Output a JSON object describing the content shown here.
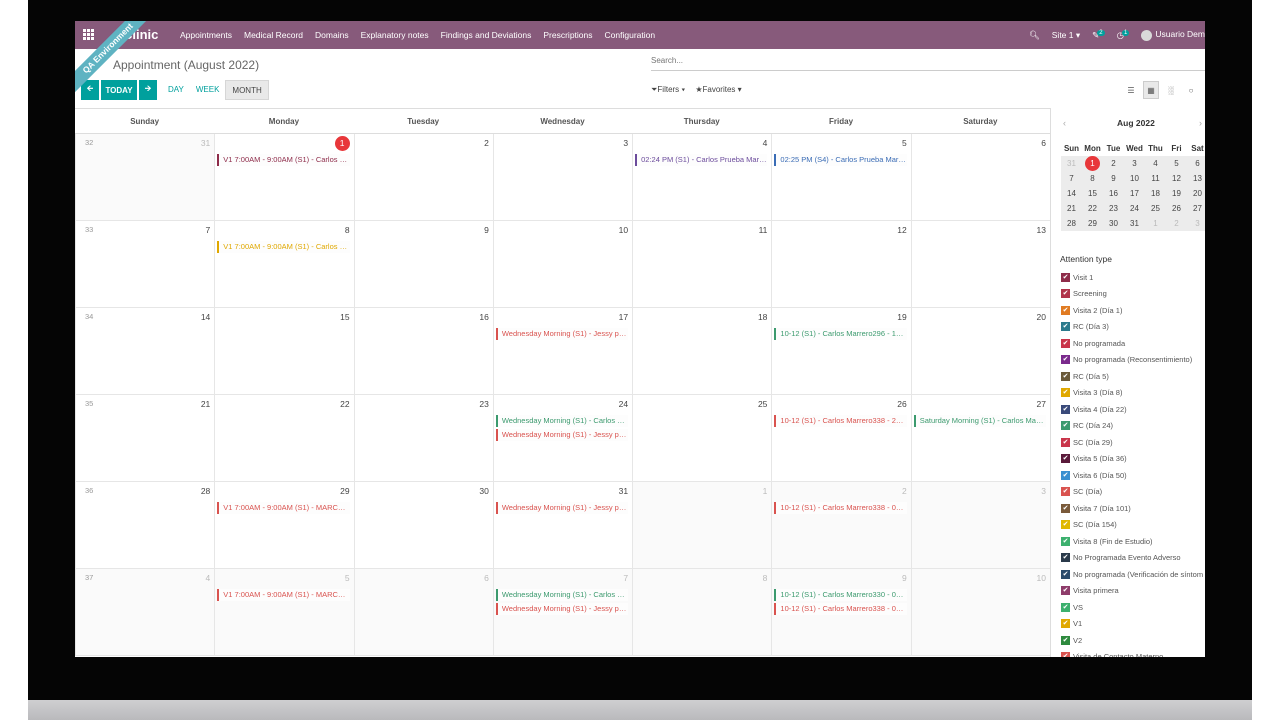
{
  "navbar": {
    "brand": "Clinic",
    "ribbon": "QA Environment",
    "menu": [
      "Appointments",
      "Medical Record",
      "Domains",
      "Explanatory notes",
      "Findings and Deviations",
      "Prescriptions",
      "Configuration"
    ],
    "site": "Site 1",
    "messages_badge": "2",
    "activity_badge": "1",
    "user": "Usuario Dem"
  },
  "control": {
    "breadcrumb": "Appointment (August 2022)",
    "search_placeholder": "Search...",
    "today_label": "TODAY",
    "prev_icon": "arrow-left-icon",
    "next_icon": "arrow-right-icon",
    "scales": [
      "DAY",
      "WEEK",
      "MONTH"
    ],
    "active_scale": "MONTH",
    "filters_label": "Filters",
    "favorites_label": "Favorites"
  },
  "calendar": {
    "weekdays": [
      "Sunday",
      "Monday",
      "Tuesday",
      "Wednesday",
      "Thursday",
      "Friday",
      "Saturday"
    ],
    "weeks": [
      {
        "num": "32",
        "days": [
          {
            "n": "31",
            "out": true,
            "events": []
          },
          {
            "n": "1",
            "today": true,
            "events": [
              {
                "t": "V1 7:00AM - 9:00AM (S1) - Carlos M...",
                "c": "#8e2c4a"
              }
            ]
          },
          {
            "n": "2",
            "events": []
          },
          {
            "n": "3",
            "events": []
          },
          {
            "n": "4",
            "events": [
              {
                "t": "02:24 PM (S1) - Carlos Prueba Marre...",
                "c": "#6c4c9c"
              }
            ]
          },
          {
            "n": "5",
            "events": [
              {
                "t": "02:25 PM (S4) - Carlos Prueba Marre...",
                "c": "#3a6cb5"
              }
            ]
          },
          {
            "n": "6",
            "events": []
          }
        ]
      },
      {
        "num": "33",
        "days": [
          {
            "n": "7",
            "events": []
          },
          {
            "n": "8",
            "events": [
              {
                "t": "V1 7:00AM - 9:00AM (S1) - Carlos M...",
                "c": "#e0a800"
              }
            ]
          },
          {
            "n": "9",
            "events": []
          },
          {
            "n": "10",
            "events": []
          },
          {
            "n": "11",
            "events": []
          },
          {
            "n": "12",
            "events": []
          },
          {
            "n": "13",
            "events": []
          }
        ]
      },
      {
        "num": "34",
        "days": [
          {
            "n": "14",
            "events": []
          },
          {
            "n": "15",
            "events": []
          },
          {
            "n": "16",
            "events": []
          },
          {
            "n": "17",
            "events": [
              {
                "t": "Wednesday Morning (S1) - Jessy pru...",
                "c": "#d9534f"
              }
            ]
          },
          {
            "n": "18",
            "events": []
          },
          {
            "n": "19",
            "events": [
              {
                "t": "10-12 (S1) - Carlos Marrero296 - 19-...",
                "c": "#3c9a6e"
              }
            ]
          },
          {
            "n": "20",
            "events": []
          }
        ]
      },
      {
        "num": "35",
        "days": [
          {
            "n": "21",
            "events": []
          },
          {
            "n": "22",
            "events": []
          },
          {
            "n": "23",
            "events": []
          },
          {
            "n": "24",
            "events": [
              {
                "t": "Wednesday Morning (S1) - Carlos M...",
                "c": "#3c9a6e"
              },
              {
                "t": "Wednesday Morning (S1) - Jessy pru...",
                "c": "#d9534f"
              }
            ]
          },
          {
            "n": "25",
            "events": []
          },
          {
            "n": "26",
            "events": [
              {
                "t": "10-12 (S1) - Carlos Marrero338 - 26-...",
                "c": "#d9534f"
              }
            ]
          },
          {
            "n": "27",
            "events": [
              {
                "t": "Saturday Morning (S1) - Carlos Marr...",
                "c": "#3c9a6e"
              }
            ]
          }
        ]
      },
      {
        "num": "36",
        "days": [
          {
            "n": "28",
            "events": []
          },
          {
            "n": "29",
            "events": [
              {
                "t": "V1 7:00AM - 9:00AM (S1) - MARCOS...",
                "c": "#d9534f"
              }
            ]
          },
          {
            "n": "30",
            "events": []
          },
          {
            "n": "31",
            "events": [
              {
                "t": "Wednesday Morning (S1) - Jessy pru...",
                "c": "#d9534f"
              }
            ]
          },
          {
            "n": "1",
            "out": true,
            "events": []
          },
          {
            "n": "2",
            "out": true,
            "events": [
              {
                "t": "10-12 (S1) - Carlos Marrero338 - 02-...",
                "c": "#d9534f"
              }
            ]
          },
          {
            "n": "3",
            "out": true,
            "events": []
          }
        ]
      },
      {
        "num": "37",
        "days": [
          {
            "n": "4",
            "out": true,
            "events": []
          },
          {
            "n": "5",
            "out": true,
            "events": [
              {
                "t": "V1 7:00AM - 9:00AM (S1) - MARCOS...",
                "c": "#d9534f"
              }
            ]
          },
          {
            "n": "6",
            "out": true,
            "events": []
          },
          {
            "n": "7",
            "out": true,
            "events": [
              {
                "t": "Wednesday Morning (S1) - Carlos M...",
                "c": "#3c9a6e"
              },
              {
                "t": "Wednesday Morning (S1) - Jessy pru...",
                "c": "#d9534f"
              }
            ]
          },
          {
            "n": "8",
            "out": true,
            "events": []
          },
          {
            "n": "9",
            "out": true,
            "events": [
              {
                "t": "10-12 (S1) - Carlos Marrero330 - 09-...",
                "c": "#3c9a6e"
              },
              {
                "t": "10-12 (S1) - Carlos Marrero338 - 09-...",
                "c": "#d9534f"
              }
            ]
          },
          {
            "n": "10",
            "out": true,
            "events": []
          }
        ]
      }
    ]
  },
  "mini_calendar": {
    "title": "Aug 2022",
    "dow": [
      "Sun",
      "Mon",
      "Tue",
      "Wed",
      "Thu",
      "Fri",
      "Sat"
    ],
    "rows": [
      [
        {
          "d": "31",
          "m": true
        },
        {
          "d": "1",
          "t": true
        },
        {
          "d": "2"
        },
        {
          "d": "3"
        },
        {
          "d": "4"
        },
        {
          "d": "5"
        },
        {
          "d": "6"
        }
      ],
      [
        {
          "d": "7"
        },
        {
          "d": "8"
        },
        {
          "d": "9"
        },
        {
          "d": "10"
        },
        {
          "d": "11"
        },
        {
          "d": "12"
        },
        {
          "d": "13"
        }
      ],
      [
        {
          "d": "14"
        },
        {
          "d": "15"
        },
        {
          "d": "16"
        },
        {
          "d": "17"
        },
        {
          "d": "18"
        },
        {
          "d": "19"
        },
        {
          "d": "20"
        }
      ],
      [
        {
          "d": "21"
        },
        {
          "d": "22"
        },
        {
          "d": "23"
        },
        {
          "d": "24"
        },
        {
          "d": "25"
        },
        {
          "d": "26"
        },
        {
          "d": "27"
        }
      ],
      [
        {
          "d": "28"
        },
        {
          "d": "29"
        },
        {
          "d": "30"
        },
        {
          "d": "31"
        },
        {
          "d": "1",
          "m": true
        },
        {
          "d": "2",
          "m": true
        },
        {
          "d": "3",
          "m": true
        }
      ]
    ]
  },
  "attention": {
    "title": "Attention type",
    "items": [
      {
        "label": "Visit 1",
        "color": "#8e2c4a"
      },
      {
        "label": "Screening",
        "color": "#b0334a"
      },
      {
        "label": "Visita 2 (Día 1)",
        "color": "#e07b22"
      },
      {
        "label": "RC (Día 3)",
        "color": "#2b7a8c"
      },
      {
        "label": "No programada",
        "color": "#c9354a"
      },
      {
        "label": "No programada (Reconsentimiento)",
        "color": "#7a2a8c"
      },
      {
        "label": "RC (Día 5)",
        "color": "#6b5a3a"
      },
      {
        "label": "Visita 3 (Día 8)",
        "color": "#e0a800"
      },
      {
        "label": "Visita 4 (Día 22)",
        "color": "#3a4a7a"
      },
      {
        "label": "RC (Día 24)",
        "color": "#3c9a6e"
      },
      {
        "label": "SC (Día 29)",
        "color": "#c9354a"
      },
      {
        "label": "Visita 5 (Día 36)",
        "color": "#5a1a3a"
      },
      {
        "label": "Visita 6 (Día 50)",
        "color": "#3a8fd0"
      },
      {
        "label": "SC (Día)",
        "color": "#d9534f"
      },
      {
        "label": "Visita 7 (Día 101)",
        "color": "#7a5a3a"
      },
      {
        "label": "SC (Día 154)",
        "color": "#e0b800"
      },
      {
        "label": "Visita 8 (Fin de Estudio)",
        "color": "#3cb06e"
      },
      {
        "label": "No Programada Evento Adverso",
        "color": "#2a3a4a"
      },
      {
        "label": "No programada (Verificación de síntom",
        "color": "#2a4a6a"
      },
      {
        "label": "Visita primera",
        "color": "#8e3c6a"
      },
      {
        "label": "VS",
        "color": "#3cb06e"
      },
      {
        "label": "V1",
        "color": "#e0a800"
      },
      {
        "label": "V2",
        "color": "#2e8a3e"
      },
      {
        "label": "Visita de Contacto Materno",
        "color": "#d9534f"
      }
    ]
  }
}
